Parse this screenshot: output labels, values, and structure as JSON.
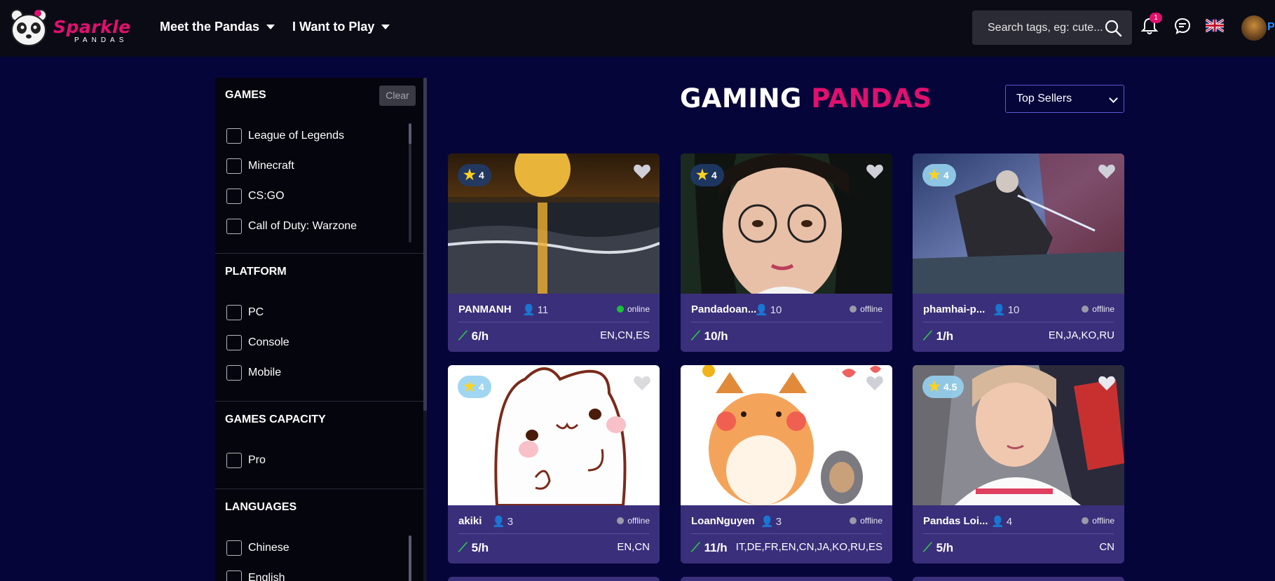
{
  "header": {
    "logo_text": "Sparkle",
    "logo_sub": "PANDAS",
    "nav": [
      {
        "label": "Meet the Pandas"
      },
      {
        "label": "I Want to Play"
      }
    ],
    "search": {
      "placeholder": "Search tags, eg: cute..."
    },
    "notification_count": "1",
    "user_initial": "P",
    "icons": [
      "bell-icon",
      "chat-icon",
      "uk-flag-icon",
      "search-icon"
    ]
  },
  "sidebar": {
    "clear_label": "Clear",
    "sections": {
      "games": {
        "title": "GAMES",
        "options": [
          "League of Legends",
          "Minecraft",
          "CS:GO",
          "Call of Duty: Warzone"
        ]
      },
      "platform": {
        "title": "PLATFORM",
        "options": [
          "PC",
          "Console",
          "Mobile"
        ]
      },
      "capacity": {
        "title": "GAMES CAPACITY",
        "options": [
          "Pro"
        ]
      },
      "languages": {
        "title": "LANGUAGES",
        "options": [
          "Chinese",
          "English"
        ]
      }
    }
  },
  "main": {
    "title_part1": "GAMING",
    "title_part2": "PANDAS",
    "sort": {
      "selected": "Top Sellers"
    },
    "accent_color": "#e0106e",
    "cards": [
      {
        "name": "PANMANH",
        "followers": "11",
        "status": "online",
        "rating": "4",
        "price": "6/h",
        "languages": "EN,CN,ES"
      },
      {
        "name": "Pandadoan...",
        "followers": "10",
        "status": "offline",
        "rating": "4",
        "price": "10/h",
        "languages": ""
      },
      {
        "name": "phamhai-p...",
        "followers": "10",
        "status": "offline",
        "rating": "4",
        "price": "1/h",
        "languages": "EN,JA,KO,RU"
      },
      {
        "name": "akiki",
        "followers": "3",
        "status": "offline",
        "rating": "4",
        "price": "5/h",
        "languages": "EN,CN"
      },
      {
        "name": "LoanNguyen",
        "followers": "3",
        "status": "offline",
        "rating": "",
        "price": "11/h",
        "languages": "IT,DE,FR,EN,CN,JA,KO,RU,ES"
      },
      {
        "name": "Pandas Loi...",
        "followers": "4",
        "status": "offline",
        "rating": "4.5",
        "price": "5/h",
        "languages": "CN"
      }
    ]
  }
}
